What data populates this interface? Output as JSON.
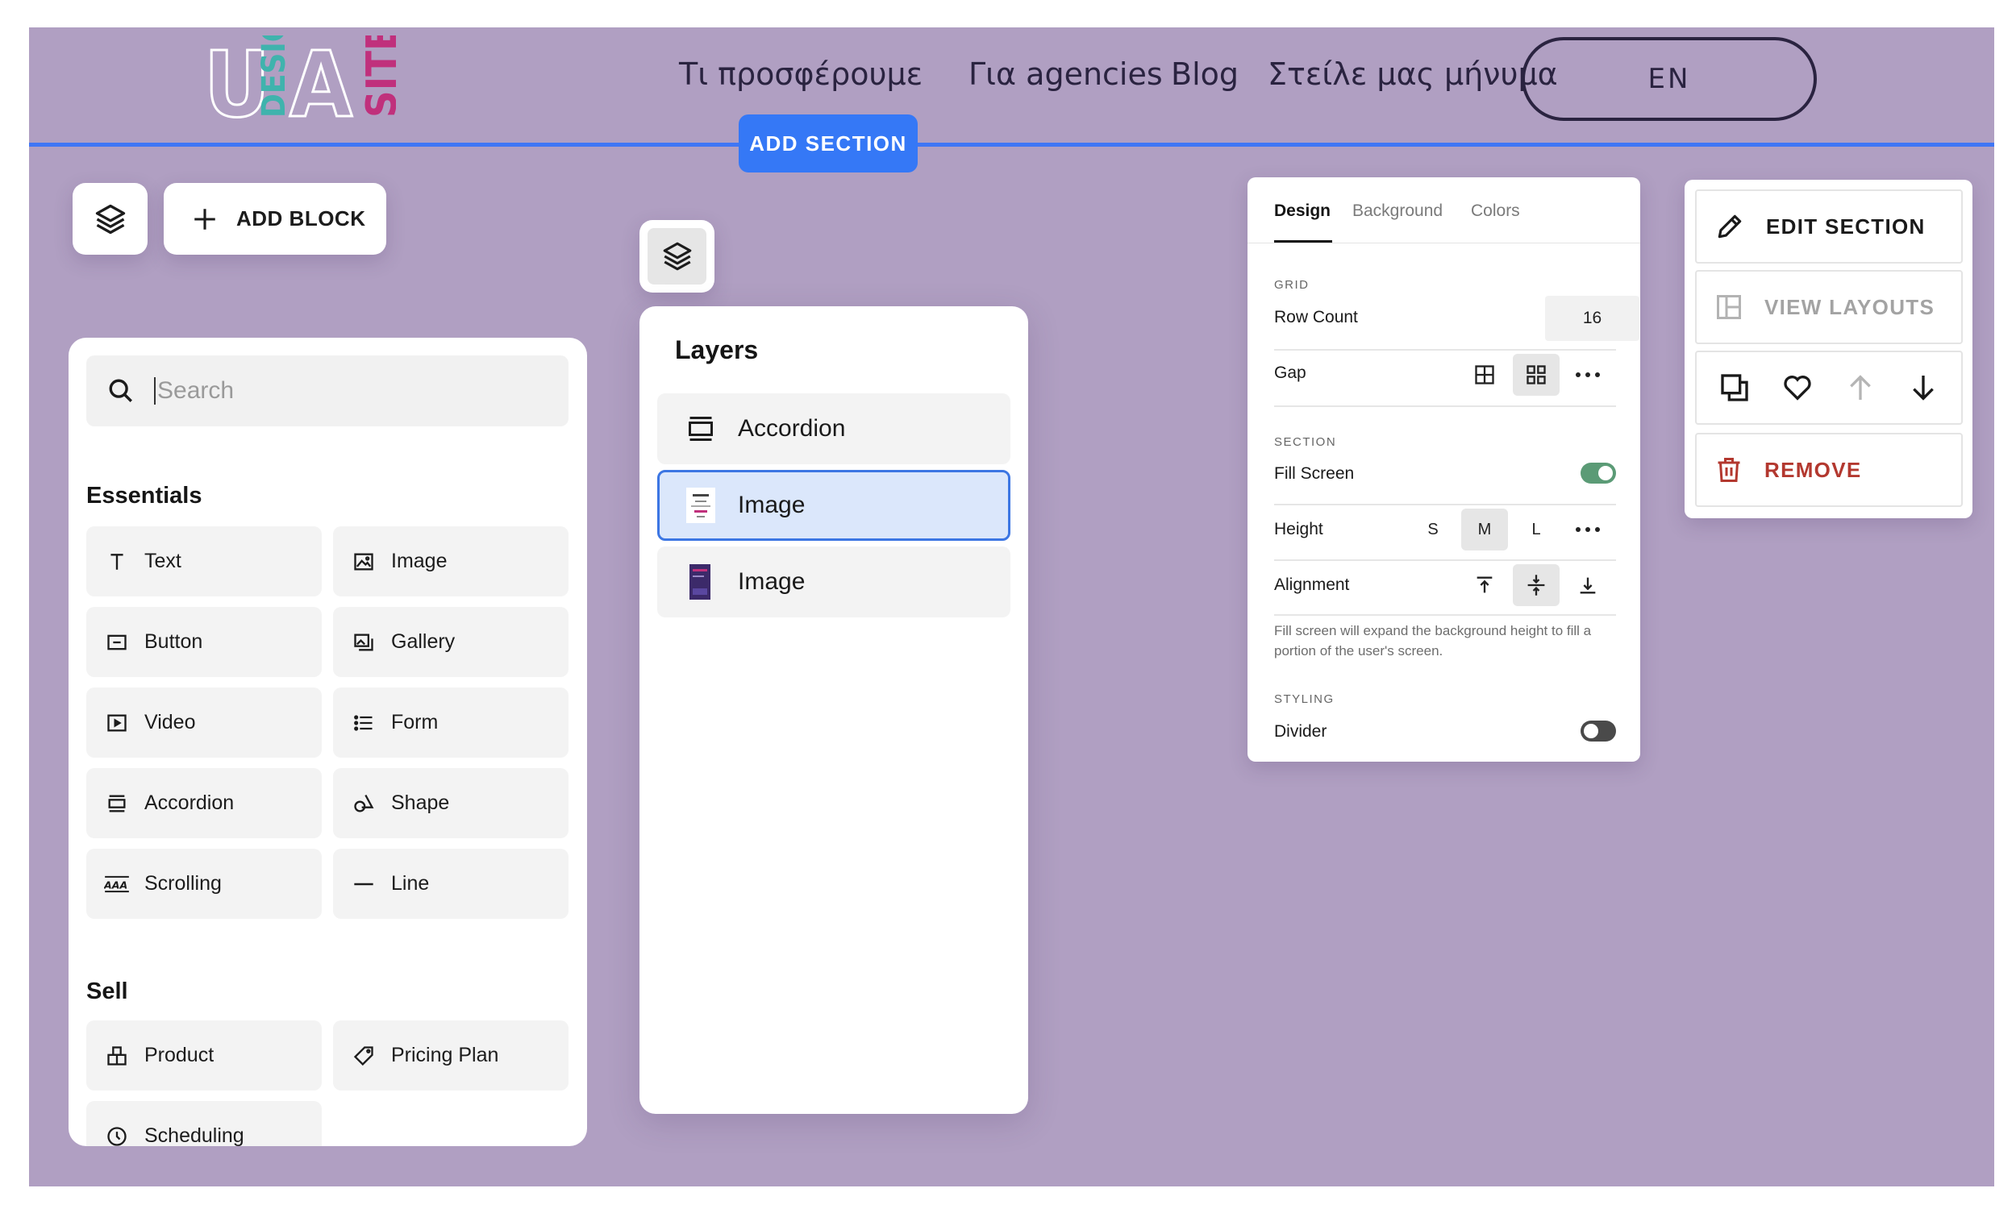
{
  "header": {
    "logo_text": [
      "U",
      "DESIGN",
      "A",
      "SITE"
    ],
    "nav": [
      "Τι προσφέρουμε",
      "Για agencies",
      "Blog",
      "Στείλε μας μήνυμα"
    ],
    "language": "EN",
    "add_section": "ADD SECTION"
  },
  "toolbar": {
    "layers_icon": "layers-icon",
    "add_block": "ADD BLOCK"
  },
  "blocks_panel": {
    "search": {
      "placeholder": "Search",
      "value": ""
    },
    "sections": [
      {
        "title": "Essentials",
        "items": [
          {
            "label": "Text",
            "icon": "text-icon"
          },
          {
            "label": "Image",
            "icon": "image-icon"
          },
          {
            "label": "Button",
            "icon": "button-icon"
          },
          {
            "label": "Gallery",
            "icon": "gallery-icon"
          },
          {
            "label": "Video",
            "icon": "video-icon"
          },
          {
            "label": "Form",
            "icon": "form-icon"
          },
          {
            "label": "Accordion",
            "icon": "accordion-icon"
          },
          {
            "label": "Shape",
            "icon": "shape-icon"
          },
          {
            "label": "Scrolling",
            "icon": "scrolling-icon"
          },
          {
            "label": "Line",
            "icon": "line-icon"
          }
        ]
      },
      {
        "title": "Sell",
        "items": [
          {
            "label": "Product",
            "icon": "product-icon"
          },
          {
            "label": "Pricing Plan",
            "icon": "pricing-tag-icon"
          },
          {
            "label": "Scheduling",
            "icon": "clock-icon"
          }
        ]
      }
    ]
  },
  "layers_panel": {
    "title": "Layers",
    "items": [
      {
        "label": "Accordion",
        "icon": "accordion-icon",
        "selected": false
      },
      {
        "label": "Image",
        "icon": "image-thumbnail",
        "selected": true
      },
      {
        "label": "Image",
        "icon": "image-thumbnail",
        "selected": false
      }
    ]
  },
  "design_panel": {
    "tabs": [
      "Design",
      "Background",
      "Colors"
    ],
    "active_tab": "Design",
    "grid": {
      "label": "GRID",
      "row_count_label": "Row Count",
      "row_count": "16",
      "gap_label": "Gap"
    },
    "section": {
      "label": "SECTION",
      "fill_screen_label": "Fill Screen",
      "fill_screen": true,
      "height_label": "Height",
      "height_options": [
        "S",
        "M",
        "L"
      ],
      "height_selected": "M",
      "alignment_label": "Alignment",
      "alignment_selected": "center",
      "help": "Fill screen will expand the background height to fill a portion of the user's screen."
    },
    "styling": {
      "label": "STYLING",
      "divider_label": "Divider",
      "divider": false
    }
  },
  "section_toolbar": {
    "edit": "EDIT SECTION",
    "view_layouts": "VIEW LAYOUTS",
    "remove": "REMOVE",
    "actions": [
      "duplicate-icon",
      "heart-icon",
      "arrow-up-icon",
      "arrow-down-icon"
    ]
  },
  "colors": {
    "canvas": "#b09fc2",
    "accent": "#3578f6",
    "toggle_on": "#5b9b76",
    "toggle_off": "#4a4a4a",
    "remove": "#b3382f",
    "logo_pink": "#c0307c",
    "logo_teal": "#3fb3ad"
  }
}
